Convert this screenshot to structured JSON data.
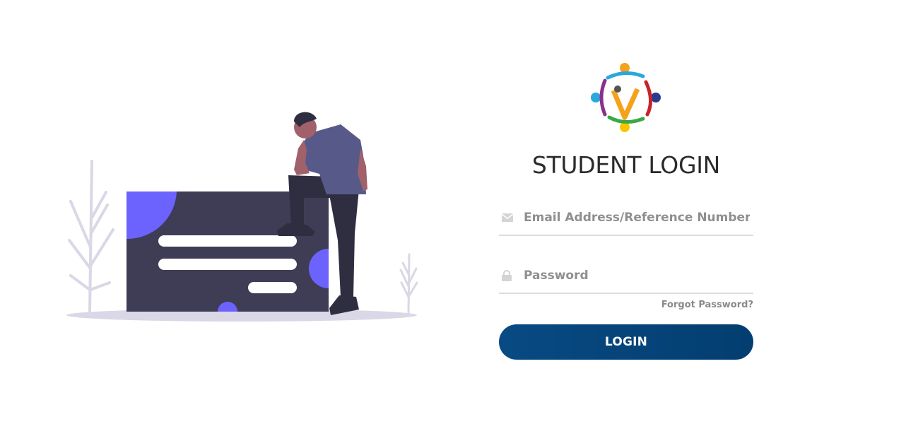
{
  "login": {
    "title": "STUDENT LOGIN",
    "email_placeholder": "Email Address/Reference Number",
    "password_placeholder": "Password",
    "forgot_label": "Forgot Password?",
    "submit_label": "LOGIN"
  },
  "icons": {
    "email": "envelope-icon",
    "password": "lock-icon",
    "logo": "institution-logo"
  },
  "colors": {
    "button": "#044276",
    "accent_purple": "#6c63ff",
    "card_dark": "#3f3d56",
    "title_text": "#2b2b2b"
  }
}
